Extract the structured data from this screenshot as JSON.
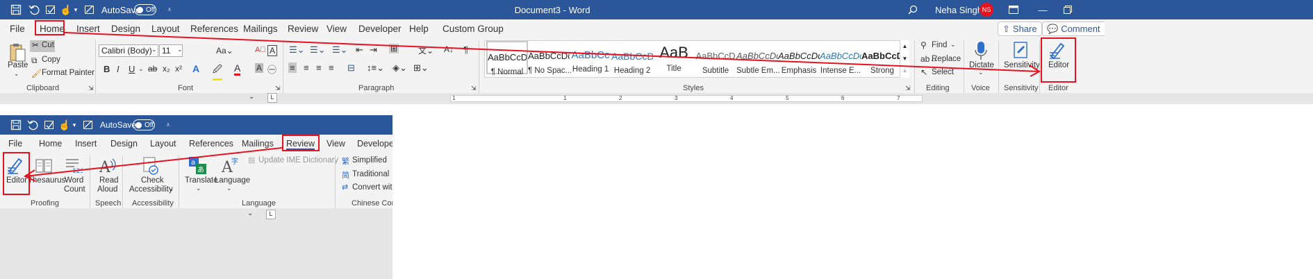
{
  "top": {
    "title": "Document3 - Word",
    "autosave": "AutoSave",
    "toggle": "Off",
    "user": "Neha Singh",
    "initials": "NS",
    "tabs": [
      "File",
      "Home",
      "Insert",
      "Design",
      "Layout",
      "References",
      "Mailings",
      "Review",
      "View",
      "Developer",
      "Help",
      "Custom Group"
    ],
    "share": "Share",
    "comment": "Comment",
    "clipboard": {
      "paste": "Paste",
      "cut": "Cut",
      "copy": "Copy",
      "format_painter": "Format Painter",
      "group": "Clipboard"
    },
    "font": {
      "name": "Calibri (Body)",
      "size": "11",
      "group": "Font"
    },
    "paragraph_group": "Paragraph",
    "styles": {
      "items": [
        {
          "preview": "AaBbCcDc",
          "name": "¶ Normal"
        },
        {
          "preview": "AaBbCcDc",
          "name": "¶ No Spac..."
        },
        {
          "preview": "AaBbCc",
          "name": "Heading 1"
        },
        {
          "preview": "AaBbCcD",
          "name": "Heading 2"
        },
        {
          "preview": "AaB",
          "name": "Title"
        },
        {
          "preview": "AaBbCcD",
          "name": "Subtitle"
        },
        {
          "preview": "AaBbCcDc",
          "name": "Subtle Em..."
        },
        {
          "preview": "AaBbCcDc",
          "name": "Emphasis"
        },
        {
          "preview": "AaBbCcDc",
          "name": "Intense E..."
        },
        {
          "preview": "AaBbCcDc",
          "name": "Strong"
        }
      ],
      "group": "Styles"
    },
    "editing": {
      "find": "Find",
      "replace": "Replace",
      "select": "Select",
      "group": "Editing"
    },
    "voice": {
      "dictate": "Dictate",
      "group": "Voice"
    },
    "sensitivity": {
      "label": "Sensitivity",
      "group": "Sensitivity"
    },
    "editor": {
      "label": "Editor",
      "group": "Editor"
    },
    "ruler_numbers": [
      "1",
      "1",
      "2",
      "3",
      "4",
      "5",
      "6",
      "7"
    ]
  },
  "bottom": {
    "autosave": "AutoSave",
    "toggle": "Off",
    "tabs": [
      "File",
      "Home",
      "Insert",
      "Design",
      "Layout",
      "References",
      "Mailings",
      "Review",
      "View",
      "Develope"
    ],
    "proofing": {
      "editor": "Editor",
      "thesaurus": "Thesaurus",
      "word_count_1": "Word",
      "word_count_2": "Count",
      "group": "Proofing"
    },
    "speech": {
      "read_1": "Read",
      "read_2": "Aloud",
      "group": "Speech"
    },
    "accessibility": {
      "check_1": "Check",
      "check_2": "Accessibility",
      "group": "Accessibility"
    },
    "language": {
      "translate": "Translate",
      "language": "Language",
      "ime": "Update IME Dictionary",
      "group": "Language"
    },
    "chinese": {
      "simplified": "Simplified",
      "traditional": "Traditional",
      "convert": "Convert with",
      "group": "Chinese Conv"
    }
  },
  "colors": {
    "title_bar": "#2b579a",
    "annotation": "#e8121f",
    "avatar": "#e8121f"
  }
}
